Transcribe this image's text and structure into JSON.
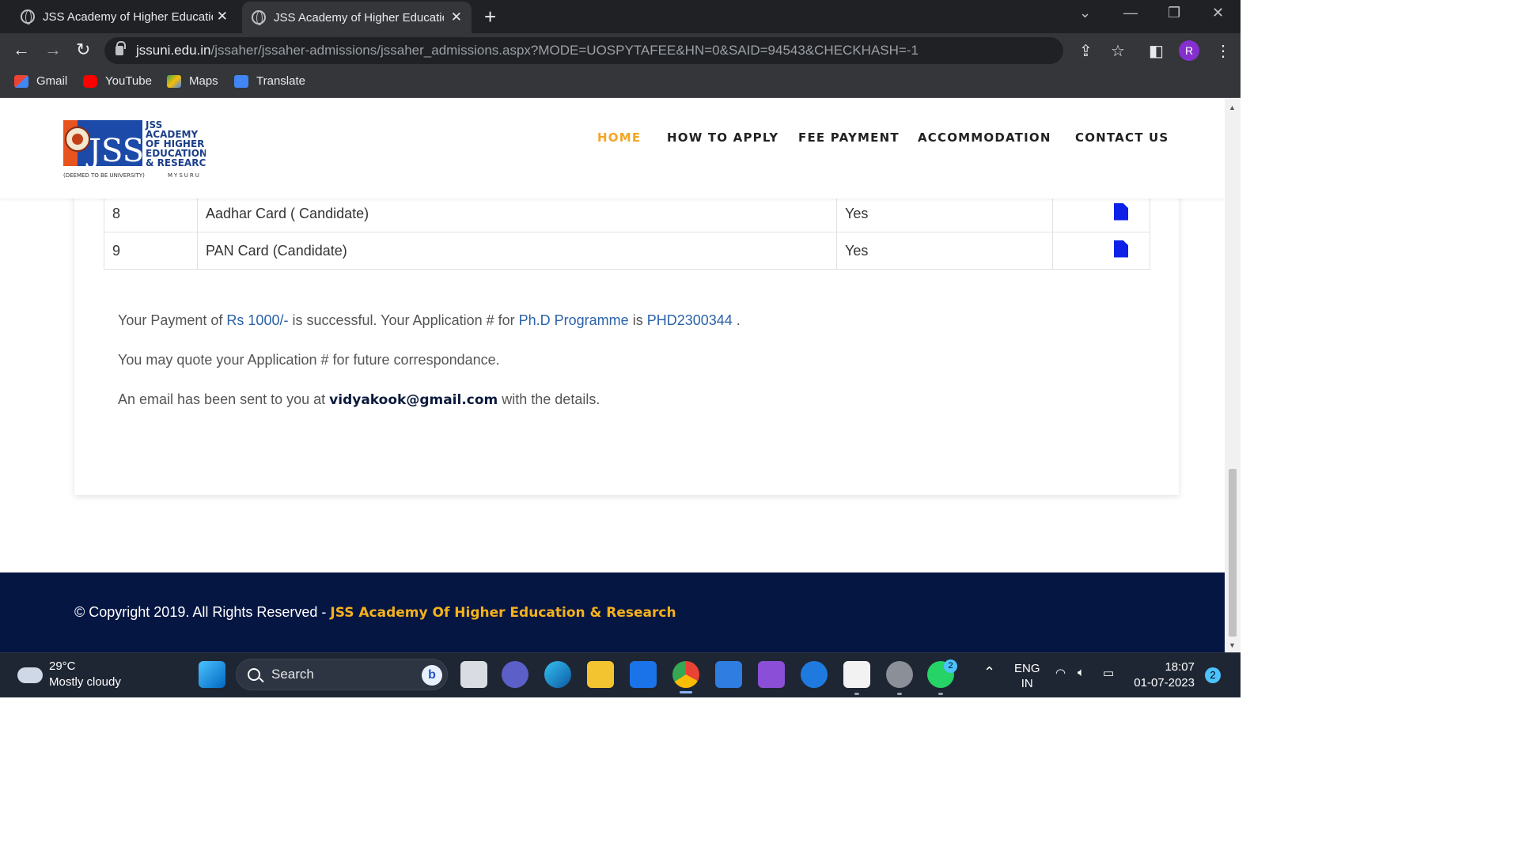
{
  "browser": {
    "tabs": [
      {
        "title": "JSS Academy of Higher Education & Research"
      },
      {
        "title": "JSS Academy of Higher Education & Research"
      }
    ],
    "new_tab": "+",
    "url_host": "jssuni.edu.in",
    "url_path": "/jssaher/jssaher-admissions/jssaher_admissions.aspx?MODE=UOSPYTAFEE&HN=0&SAID=94543&CHECKHASH=-1",
    "profile_initial": "R",
    "bookmarks": [
      {
        "label": "Gmail",
        "icon": "gmail-icon"
      },
      {
        "label": "YouTube",
        "icon": "youtube-icon"
      },
      {
        "label": "Maps",
        "icon": "maps-icon"
      },
      {
        "label": "Translate",
        "icon": "translate-icon"
      }
    ]
  },
  "site": {
    "logo": {
      "letters": "JSS",
      "line1": "JSS",
      "line2": "ACADEMY",
      "line3": "OF HIGHER",
      "line4": "EDUCATION",
      "line5": "& RESEARCH",
      "tag_left": "(DEEMED TO BE UNIVERSITY)",
      "tag_right": "MYSURU"
    },
    "nav": [
      "HOME",
      "HOW TO APPLY",
      "FEE PAYMENT",
      "ACCOMMODATION",
      "CONTACT US"
    ],
    "active_nav": "HOME"
  },
  "documents": {
    "rows": [
      {
        "no": "8",
        "name": "Aadhar Card ( Candidate)",
        "uploaded": "Yes"
      },
      {
        "no": "9",
        "name": "PAN Card (Candidate)",
        "uploaded": "Yes"
      }
    ]
  },
  "confirmation": {
    "l1_a": "Your Payment of ",
    "amount": "Rs 1000/-",
    "l1_b": " is successful. Your Application # for ",
    "programme": "Ph.D Programme",
    "l1_c": " is ",
    "application_no": "PHD2300344",
    "l1_d": " .",
    "l2": "You may quote your Application # for future correspondance.",
    "l3_a": "An email has been sent to you at ",
    "email": "vidyakook@gmail.com",
    "l3_b": " with the details."
  },
  "footer": {
    "copyright": "© Copyright 2019. All Rights Reserved - ",
    "brand": "JSS Academy Of Higher Education & Research"
  },
  "taskbar": {
    "weather_temp": "29°C",
    "weather_cond": "Mostly cloudy",
    "search_label": "Search",
    "lang_top": "ENG",
    "lang_bottom": "IN",
    "time": "18:07",
    "date": "01-07-2023",
    "notifications": "2",
    "whatsapp_badge": "2"
  },
  "colors": {
    "nav_active": "#f5a623",
    "link_blue": "#2a62a8",
    "footer_bg": "#061643",
    "footer_brand": "#f5b21c",
    "file_icon": "#0d21e8"
  }
}
